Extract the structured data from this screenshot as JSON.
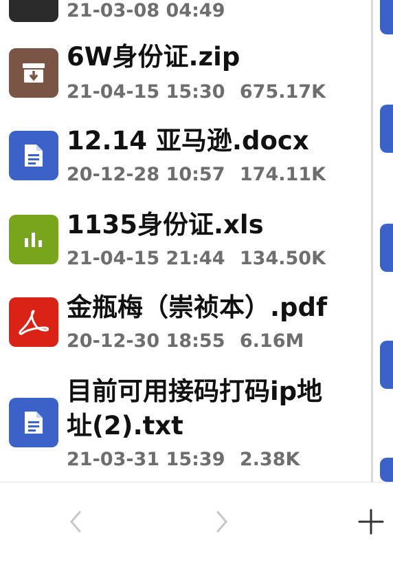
{
  "files": [
    {
      "name": "",
      "date": "21-03-08 04:49",
      "size": "",
      "icon": "generic-dark",
      "color": "#2b2b2b"
    },
    {
      "name": "6W身份证.zip",
      "date": "21-04-15 15:30",
      "size": "675.17K",
      "icon": "archive-icon",
      "color": "#7a5546"
    },
    {
      "name": "12.14 亚马逊.docx",
      "date": "20-12-28 10:57",
      "size": "174.11K",
      "icon": "document-icon",
      "color": "#3b63c7"
    },
    {
      "name": "1135身份证.xls",
      "date": "21-04-15 21:44",
      "size": "134.50K",
      "icon": "spreadsheet-chart-icon",
      "color": "#78a51c"
    },
    {
      "name": "金瓶梅（崇祯本）.pdf",
      "date": "20-12-30 18:55",
      "size": "6.16M",
      "icon": "pdf-icon",
      "color": "#d92316"
    },
    {
      "name_line1": "目前可用接码打码ip地",
      "name_line2": "址(2).txt",
      "date": "21-03-31 15:39",
      "size": "2.38K",
      "icon": "document-icon",
      "color": "#3b63c7"
    }
  ],
  "bottom_bar": {
    "back_symbol": "‹",
    "forward_symbol": "›",
    "add_symbol": "+"
  }
}
